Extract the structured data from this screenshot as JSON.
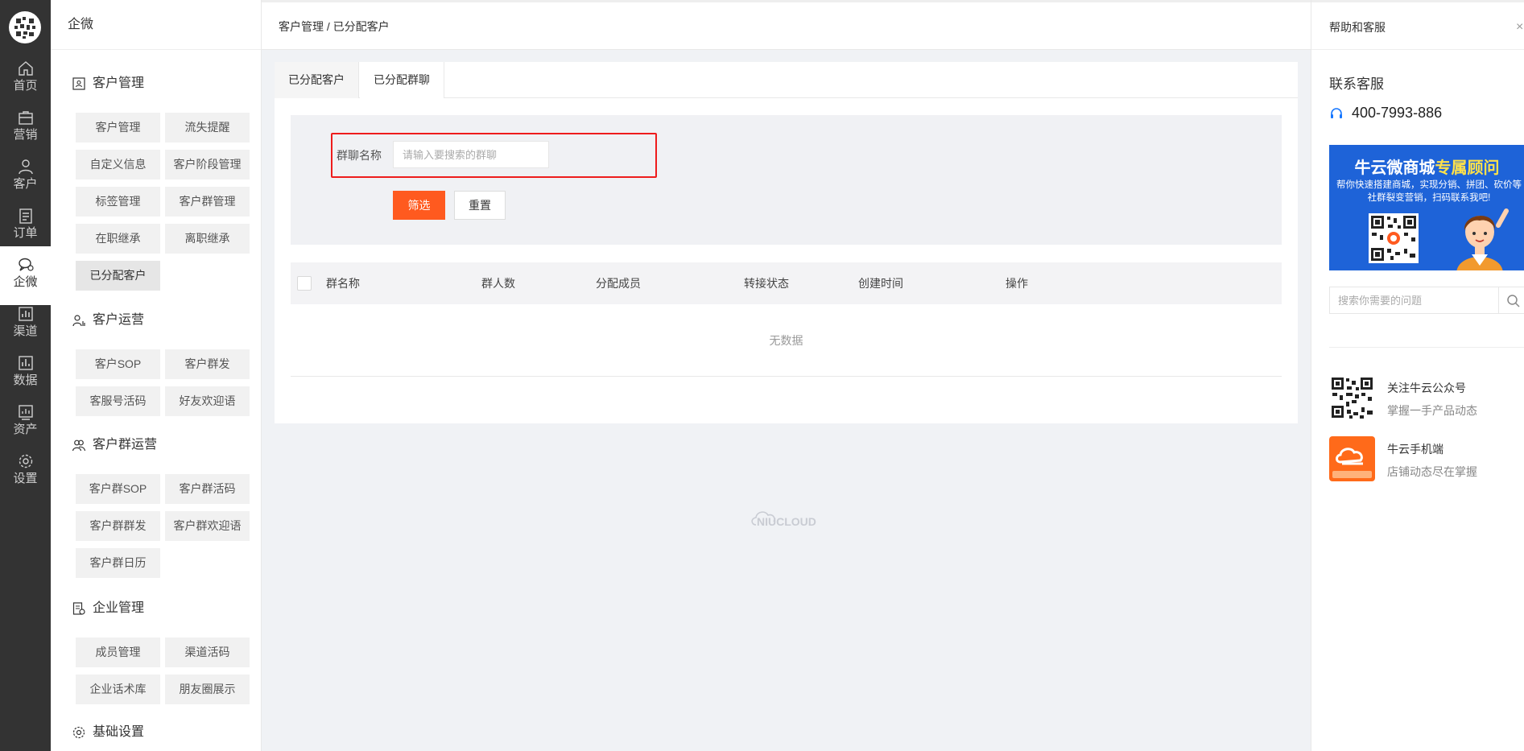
{
  "rail": {
    "items": [
      {
        "label": "首页",
        "icon": "home-icon"
      },
      {
        "label": "营销",
        "icon": "bag-icon"
      },
      {
        "label": "客户",
        "icon": "user-icon"
      },
      {
        "label": "订单",
        "icon": "order-icon"
      },
      {
        "label": "企微",
        "icon": "chat-icon"
      },
      {
        "label": "渠道",
        "icon": "channel-icon"
      },
      {
        "label": "数据",
        "icon": "data-icon"
      },
      {
        "label": "资产",
        "icon": "asset-icon"
      },
      {
        "label": "设置",
        "icon": "gear-icon"
      }
    ],
    "active_index": 4
  },
  "subnav": {
    "title": "企微",
    "groups": [
      {
        "label": "客户管理",
        "icon": "contact-card-icon",
        "items": [
          "客户管理",
          "流失提醒",
          "自定义信息",
          "客户阶段管理",
          "标签管理",
          "客户群管理",
          "在职继承",
          "离职继承",
          "已分配客户"
        ]
      },
      {
        "label": "客户运营",
        "icon": "user-ops-icon",
        "items": [
          "客户SOP",
          "客户群发",
          "客服号活码",
          "好友欢迎语"
        ]
      },
      {
        "label": "客户群运营",
        "icon": "group-icon",
        "items": [
          "客户群SOP",
          "客户群活码",
          "客户群群发",
          "客户群欢迎语",
          "客户群日历"
        ]
      },
      {
        "label": "企业管理",
        "icon": "enterprise-icon",
        "items": [
          "成员管理",
          "渠道活码",
          "企业话术库",
          "朋友圈展示"
        ]
      },
      {
        "label": "基础设置",
        "icon": "settings-gear-icon",
        "items": []
      }
    ],
    "active_item": "已分配客户"
  },
  "breadcrumb": "客户管理 / 已分配客户",
  "tabs": [
    {
      "label": "已分配客户"
    },
    {
      "label": "已分配群聊"
    }
  ],
  "active_tab": 1,
  "filter": {
    "label": "群聊名称",
    "placeholder": "请输入要搜索的群聊",
    "value": "",
    "filter_button": "筛选",
    "reset_button": "重置"
  },
  "table": {
    "columns": [
      "群名称",
      "群人数",
      "分配成员",
      "转接状态",
      "创建时间",
      "操作"
    ],
    "empty_text": "无数据"
  },
  "watermark": "NIUCLOUD",
  "help": {
    "title": "帮助和客服",
    "close_glyph": "×",
    "contact_label": "联系客服",
    "phone": "400-7993-886",
    "banner_title_a": "牛云微商城",
    "banner_title_b": "专属顾问",
    "banner_sub": "帮你快速搭建商城，实现分销、拼团、砍价等社群裂变营销，扫码联系我吧!",
    "search_placeholder": "搜索你需要的问题",
    "items": [
      {
        "title": "关注牛云公众号",
        "sub": "掌握一手产品动态"
      },
      {
        "title": "牛云手机端",
        "sub": "店铺动态尽在掌握"
      }
    ]
  },
  "colors": {
    "rail_bg": "#333333",
    "accent": "#ff5a1f",
    "highlight_border": "#ee1c1c",
    "banner_bg": "#1e63d8"
  }
}
